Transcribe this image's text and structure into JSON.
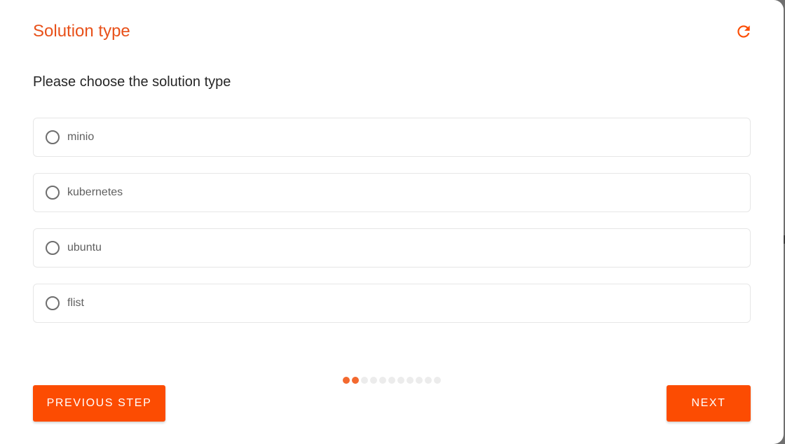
{
  "dialog": {
    "title": "Solution type",
    "refresh_icon": "refresh-icon",
    "question": "Please choose the solution type"
  },
  "options": [
    {
      "label": "minio",
      "selected": false
    },
    {
      "label": "kubernetes",
      "selected": false
    },
    {
      "label": "ubuntu",
      "selected": false
    },
    {
      "label": "flist",
      "selected": false
    }
  ],
  "stepper": {
    "total_steps": 11,
    "completed_steps": 2
  },
  "buttons": {
    "previous_label": "PREVIOUS STEP",
    "next_label": "NEXT"
  },
  "colors": {
    "accent": "#fc4c02",
    "title": "#e8511a",
    "step_done": "#f3692f",
    "step_pending": "#ececec"
  }
}
